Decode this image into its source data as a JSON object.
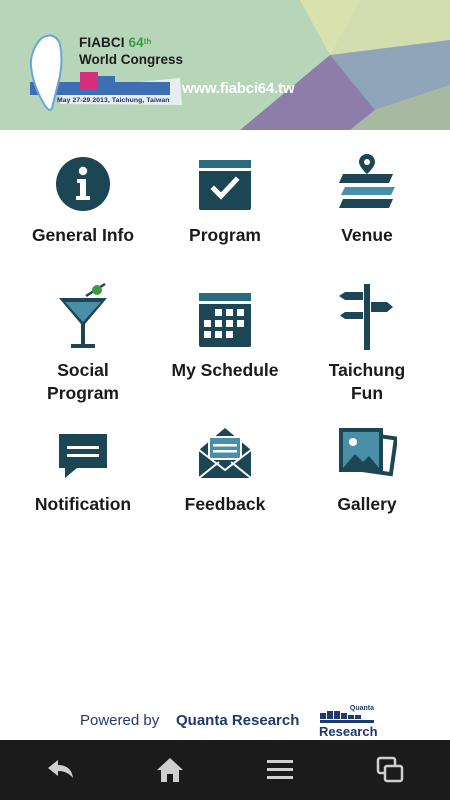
{
  "banner": {
    "org": "FIABCI",
    "edition_number": "64",
    "edition_suffix": "th",
    "event": "World Congress",
    "dates": "May 27-29 2013, Taichung, Taiwan",
    "url": "www.fiabci64.tw"
  },
  "menu": [
    {
      "id": "general-info",
      "label": "General Info",
      "icon": "info-icon"
    },
    {
      "id": "program",
      "label": "Program",
      "icon": "calendar-check-icon"
    },
    {
      "id": "venue",
      "label": "Venue",
      "icon": "map-layers-icon"
    },
    {
      "id": "social-program",
      "label_line1": "Social",
      "label_line2": "Program",
      "icon": "cocktail-icon"
    },
    {
      "id": "my-schedule",
      "label": "My Schedule",
      "icon": "calendar-grid-icon"
    },
    {
      "id": "taichung-fun",
      "label_line1": "Taichung",
      "label_line2": "Fun",
      "icon": "signpost-icon"
    },
    {
      "id": "notification",
      "label": "Notification",
      "icon": "message-icon"
    },
    {
      "id": "feedback",
      "label": "Feedback",
      "icon": "envelope-icon"
    },
    {
      "id": "gallery",
      "label": "Gallery",
      "icon": "photos-icon"
    }
  ],
  "footer": {
    "powered_by": "Powered by",
    "company": "Quanta Research",
    "logo_top": "Quanta",
    "logo_bottom": "Research"
  },
  "navbar": {
    "buttons": [
      "back-icon",
      "home-icon",
      "menu-icon",
      "recent-apps-icon"
    ]
  },
  "colors": {
    "icon": "#1d4654",
    "label": "#1a1a1a",
    "navbar": "#1b1b1b",
    "brand_blue": "#1f3a6e",
    "banner_green": "#b9d7bb"
  }
}
